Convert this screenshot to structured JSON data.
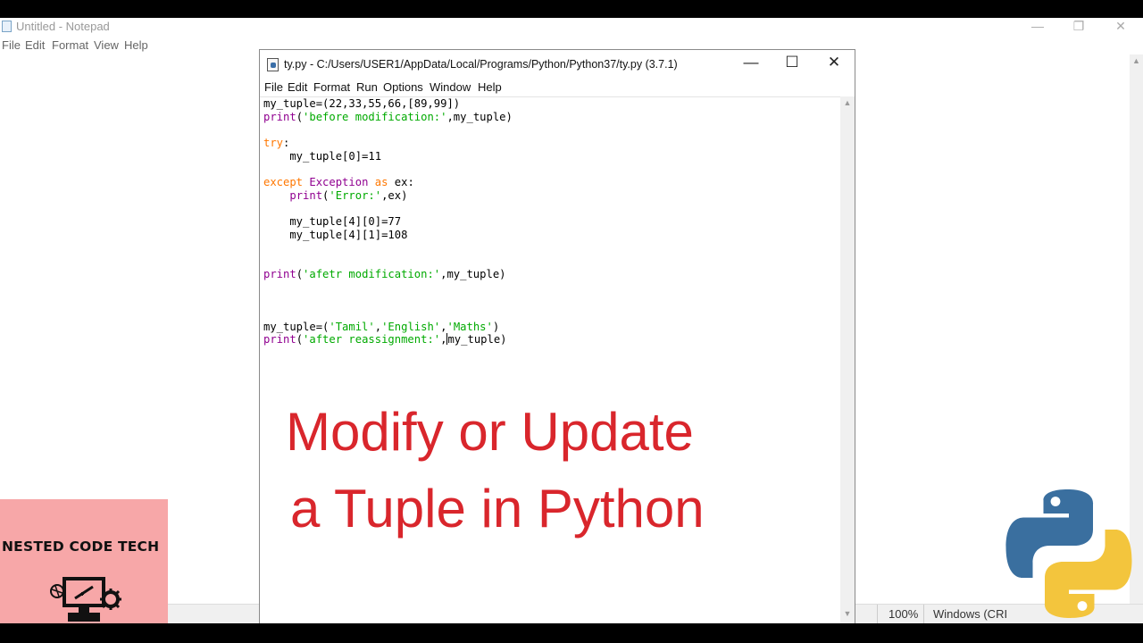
{
  "notepad": {
    "title": "Untitled - Notepad",
    "menu": [
      "File",
      "Edit",
      "Format",
      "View",
      "Help"
    ],
    "status": {
      "zoom": "100%",
      "encoding": "Windows (CRI"
    },
    "controls": {
      "minimize": "—",
      "restore": "❐",
      "close": "✕"
    }
  },
  "idle": {
    "title": "ty.py - C:/Users/USER1/AppData/Local/Programs/Python/Python37/ty.py (3.7.1)",
    "menu": [
      "File",
      "Edit",
      "Format",
      "Run",
      "Options",
      "Window",
      "Help"
    ],
    "controls": {
      "minimize": "—",
      "maximize": "☐",
      "close": "✕"
    }
  },
  "overlay": {
    "line1": "Modify or Update",
    "line2": "a Tuple in Python"
  },
  "brand": {
    "name": "NESTED CODE TECH"
  },
  "colors": {
    "keyword": "#ff7700",
    "builtin": "#900090",
    "string": "#00aa00",
    "overlay_text": "#d9262c",
    "brand_bg": "#f7a7a8"
  },
  "code_lines": [
    [
      [
        "t",
        "my_tuple=(22,33,55,66,[89,99])"
      ]
    ],
    [
      [
        "b",
        "print"
      ],
      [
        "t",
        "("
      ],
      [
        "s",
        "'before modification:'"
      ],
      [
        "t",
        ",my_tuple)"
      ]
    ],
    [],
    [
      [
        "k",
        "try"
      ],
      [
        "t",
        ":"
      ]
    ],
    [
      [
        "t",
        "    my_tuple[0]=11"
      ]
    ],
    [],
    [
      [
        "k",
        "except"
      ],
      [
        "t",
        " "
      ],
      [
        "b",
        "Exception"
      ],
      [
        "t",
        " "
      ],
      [
        "k",
        "as"
      ],
      [
        "t",
        " ex:"
      ]
    ],
    [
      [
        "t",
        "    "
      ],
      [
        "b",
        "print"
      ],
      [
        "t",
        "("
      ],
      [
        "s",
        "'Error:'"
      ],
      [
        "t",
        ",ex)"
      ]
    ],
    [],
    [
      [
        "t",
        "    my_tuple[4][0]=77"
      ]
    ],
    [
      [
        "t",
        "    my_tuple[4][1]=108"
      ]
    ],
    [],
    [],
    [
      [
        "b",
        "print"
      ],
      [
        "t",
        "("
      ],
      [
        "s",
        "'afetr modification:'"
      ],
      [
        "t",
        ",my_tuple)"
      ]
    ],
    [],
    [],
    [],
    [
      [
        "t",
        "my_tuple=("
      ],
      [
        "s",
        "'Tamil'"
      ],
      [
        "t",
        ","
      ],
      [
        "s",
        "'English'"
      ],
      [
        "t",
        ","
      ],
      [
        "s",
        "'Maths'"
      ],
      [
        "t",
        ")"
      ]
    ],
    [
      [
        "b",
        "print"
      ],
      [
        "t",
        "("
      ],
      [
        "s",
        "'after reassignment:'"
      ],
      [
        "t",
        ","
      ],
      [
        "c",
        ""
      ],
      [
        "t",
        "my_tuple)"
      ]
    ]
  ]
}
